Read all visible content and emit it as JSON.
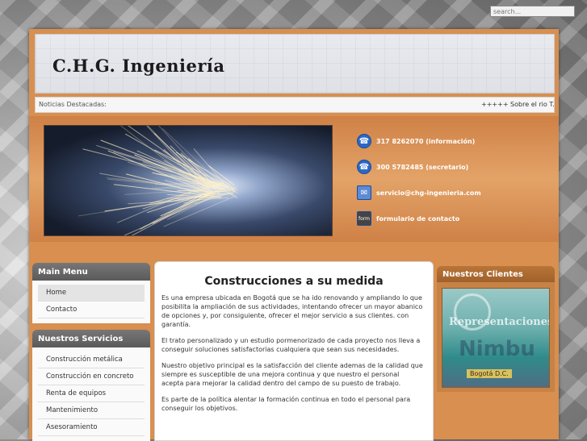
{
  "search": {
    "placeholder": "search..."
  },
  "header": {
    "title": "C.H.G. Ingeniería"
  },
  "news": {
    "label": "Noticias Destacadas:",
    "ticker": "+++++ Sobre el rio T..."
  },
  "contacts": [
    {
      "icon": "phone-icon",
      "text": "317 8262070 (información)"
    },
    {
      "icon": "phone-icon",
      "text": "300 5782485 (secretario)"
    },
    {
      "icon": "mail-icon",
      "text": "servicio@chg-ingenieria.com"
    },
    {
      "icon": "form-icon",
      "text": "formulario de contacto"
    }
  ],
  "main_menu": {
    "title": "Main Menu",
    "items": [
      "Home",
      "Contacto"
    ]
  },
  "services": {
    "title": "Nuestros Servicios",
    "items": [
      "Construcción metálica",
      "Construcción en concreto",
      "Renta de equipos",
      "Mantenimiento",
      "Asesoramiento"
    ]
  },
  "content": {
    "heading": "Construcciones a su medida",
    "paragraphs": [
      "Es una empresa ubicada en Bogotá que se ha ido renovando y ampliando lo que posibilita la ampliación de sus actividades, intentando ofrecer un mayor abanico de opciones y, por consiguiente, ofrecer el mejor servicio a sus clientes. con garantía.",
      "El trato personalizado y un estudio pormenorizado de cada proyecto nos lleva a conseguir soluciones satisfactorias cualquiera que sean sus necesidades.",
      "Nuestro objetivo principal es la satisfacción del cliente ademas de la calidad que siempre es susceptible de una mejora continua y que nuestro el personal acepta para mejorar la calidad dentro del campo de su puesto de trabajo.",
      "Es parte de la política alentar la formación continua en todo el personal para conseguir los objetivos."
    ]
  },
  "clients": {
    "title": "Nuestros Clientes",
    "image_text": [
      "Representaciones",
      "Nimbu",
      "Bogotá D.C."
    ]
  },
  "colors": {
    "accent": "#d88f4f",
    "panel_dark": "#5a5a5a",
    "link": "#2b69c9"
  }
}
